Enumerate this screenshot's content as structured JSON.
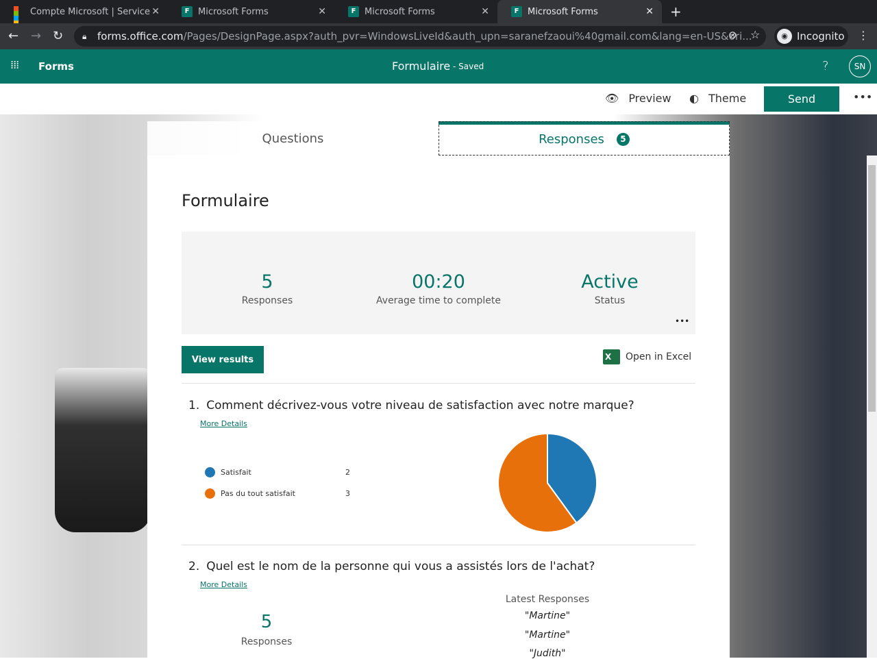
{
  "browser": {
    "tabs": [
      {
        "label": "Compte Microsoft | Service"
      },
      {
        "label": "Microsoft Forms"
      },
      {
        "label": "Microsoft Forms"
      },
      {
        "label": "Microsoft Forms"
      }
    ],
    "url_host": "forms.office.com",
    "url_path": "/Pages/DesignPage.aspx?auth_pvr=WindowsLiveId&auth_upn=saranefzaoui%40gmail.com&lang=en-US&ori...",
    "incognito": "Incognito"
  },
  "header": {
    "app": "Forms",
    "title": "Formulaire",
    "status": "- Saved",
    "help": "?",
    "avatar": "SN"
  },
  "toolbar": {
    "preview": "Preview",
    "theme": "Theme",
    "send": "Send"
  },
  "tabs": {
    "questions": "Questions",
    "responses": "Responses",
    "responses_count": "5"
  },
  "form": {
    "title": "Formulaire",
    "stats": [
      {
        "value": "5",
        "label": "Responses"
      },
      {
        "value": "00:20",
        "label": "Average time to complete"
      },
      {
        "value": "Active",
        "label": "Status"
      }
    ],
    "view_results": "View results",
    "open_excel": "Open in Excel",
    "q1": {
      "number": "1.",
      "text": "Comment décrivez-vous votre niveau de satisfaction avec notre marque?",
      "more": "More Details"
    },
    "q2": {
      "number": "2.",
      "text": "Quel est le nom de la personne qui vous a assistés lors de l'achat?",
      "more": "More Details",
      "count": "5",
      "count_label": "Responses",
      "latest_label": "Latest Responses",
      "latest": [
        "\"Martine\"",
        "\"Martine\"",
        "\"Judith\""
      ]
    }
  },
  "chart_data": {
    "type": "pie",
    "categories": [
      "Satisfait",
      "Pas du tout satisfait"
    ],
    "values": [
      2,
      3
    ],
    "colors": [
      "#1f77b4",
      "#e8700a"
    ]
  }
}
